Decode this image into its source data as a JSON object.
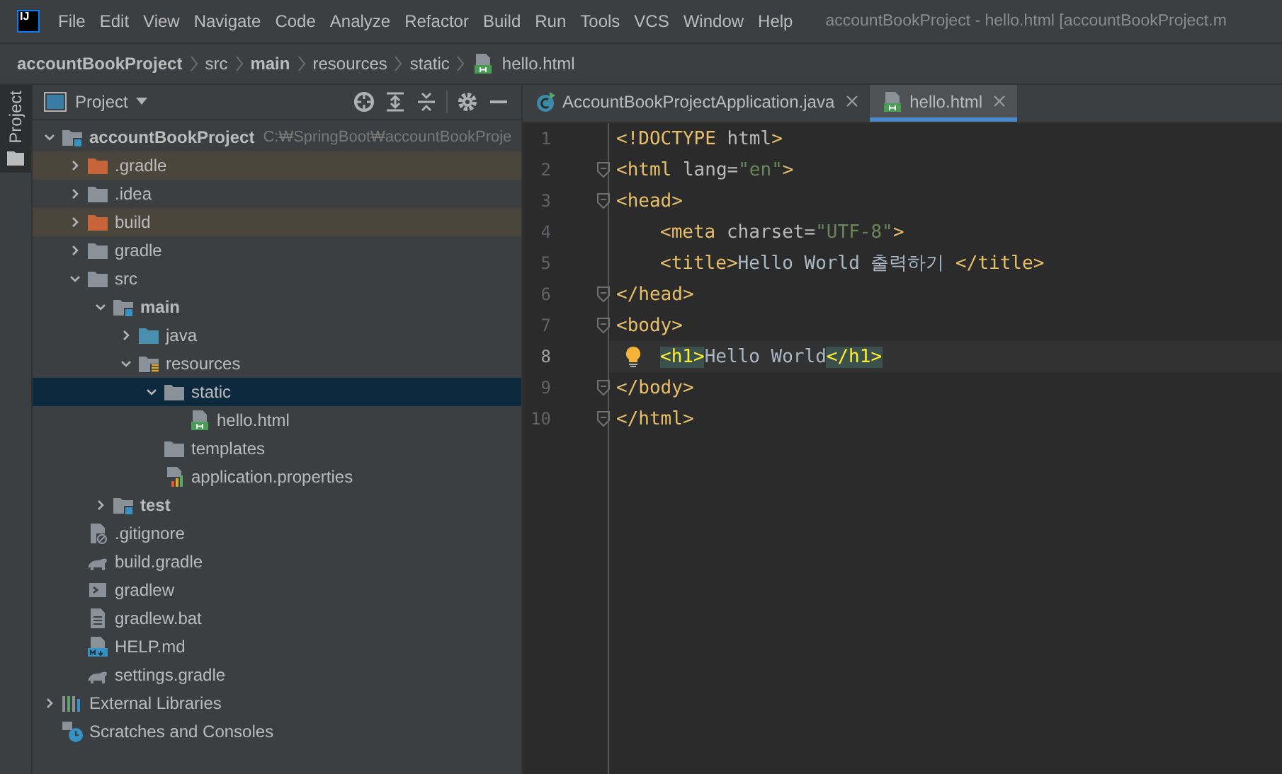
{
  "menu_bar": {
    "logo": "IJ",
    "items": [
      "File",
      "Edit",
      "View",
      "Navigate",
      "Code",
      "Analyze",
      "Refactor",
      "Build",
      "Run",
      "Tools",
      "VCS",
      "Window",
      "Help"
    ],
    "title": "accountBookProject - hello.html [accountBookProject.m"
  },
  "breadcrumb": [
    {
      "label": "accountBookProject",
      "bold": true,
      "kind": "plain"
    },
    {
      "label": "src",
      "bold": false,
      "kind": "plain"
    },
    {
      "label": "main",
      "bold": true,
      "kind": "plain"
    },
    {
      "label": "resources",
      "bold": false,
      "kind": "plain"
    },
    {
      "label": "static",
      "bold": false,
      "kind": "plain"
    },
    {
      "label": "hello.html",
      "bold": false,
      "kind": "html"
    }
  ],
  "side_stripe": {
    "label": "Project",
    "selected": true
  },
  "project_panel": {
    "title": "Project",
    "tree": [
      {
        "label": "accountBookProject",
        "path": "C:₩SpringBoot₩accountBookProje",
        "kind": "module",
        "bold": true,
        "expanded": true,
        "selected": false,
        "excluded": false,
        "children": [
          {
            "label": ".gradle",
            "kind": "folder-excluded",
            "bold": false,
            "expanded": false,
            "selected": false,
            "excluded": true
          },
          {
            "label": ".idea",
            "kind": "folder",
            "bold": false,
            "expanded": false,
            "selected": false,
            "excluded": false
          },
          {
            "label": "build",
            "kind": "folder-excluded",
            "bold": false,
            "expanded": false,
            "selected": false,
            "excluded": true
          },
          {
            "label": "gradle",
            "kind": "folder",
            "bold": false,
            "expanded": false,
            "selected": false,
            "excluded": false
          },
          {
            "label": "src",
            "kind": "folder",
            "bold": false,
            "expanded": true,
            "selected": false,
            "excluded": false,
            "children": [
              {
                "label": "main",
                "kind": "module",
                "bold": true,
                "expanded": true,
                "selected": false,
                "excluded": false,
                "children": [
                  {
                    "label": "java",
                    "kind": "folder-source",
                    "bold": false,
                    "expanded": false,
                    "selected": false,
                    "excluded": false
                  },
                  {
                    "label": "resources",
                    "kind": "folder-resources",
                    "bold": false,
                    "expanded": true,
                    "selected": false,
                    "excluded": false,
                    "children": [
                      {
                        "label": "static",
                        "kind": "folder",
                        "bold": false,
                        "expanded": true,
                        "selected": true,
                        "excluded": false,
                        "children": [
                          {
                            "label": "hello.html",
                            "kind": "html",
                            "bold": false,
                            "selected": false,
                            "excluded": false
                          }
                        ]
                      },
                      {
                        "label": "templates",
                        "kind": "folder",
                        "bold": false,
                        "selected": false,
                        "excluded": false
                      },
                      {
                        "label": "application.properties",
                        "kind": "properties",
                        "bold": false,
                        "selected": false,
                        "excluded": false
                      }
                    ]
                  }
                ]
              },
              {
                "label": "test",
                "kind": "module",
                "bold": true,
                "expanded": false,
                "selected": false,
                "excluded": false
              }
            ]
          },
          {
            "label": ".gitignore",
            "kind": "gitignore",
            "bold": false,
            "selected": false,
            "excluded": false
          },
          {
            "label": "build.gradle",
            "kind": "gradle",
            "bold": false,
            "selected": false,
            "excluded": false
          },
          {
            "label": "gradlew",
            "kind": "script",
            "bold": false,
            "selected": false,
            "excluded": false
          },
          {
            "label": "gradlew.bat",
            "kind": "text",
            "bold": false,
            "selected": false,
            "excluded": false
          },
          {
            "label": "HELP.md",
            "kind": "markdown",
            "bold": false,
            "selected": false,
            "excluded": false
          },
          {
            "label": "settings.gradle",
            "kind": "gradle",
            "bold": false,
            "selected": false,
            "excluded": false
          }
        ]
      },
      {
        "label": "External Libraries",
        "kind": "libraries",
        "bold": false,
        "expanded": false,
        "selected": false,
        "excluded": false
      },
      {
        "label": "Scratches and Consoles",
        "kind": "scratches",
        "bold": false,
        "selected": false,
        "excluded": false
      }
    ]
  },
  "editor": {
    "tabs": [
      {
        "label": "AccountBookProjectApplication.java",
        "kind": "java",
        "selected": false
      },
      {
        "label": "hello.html",
        "kind": "html",
        "selected": true
      }
    ],
    "lines": [
      {
        "number": "1",
        "indented": false,
        "fold": false,
        "current": false,
        "bulb": false,
        "tokens": [
          {
            "kind": "tag",
            "text": "<!DOCTYPE "
          },
          {
            "kind": "attr",
            "text": "html"
          },
          {
            "kind": "tag",
            "text": ">"
          }
        ]
      },
      {
        "number": "2",
        "indented": false,
        "fold": true,
        "current": false,
        "bulb": false,
        "tokens": [
          {
            "kind": "tag",
            "text": "<html "
          },
          {
            "kind": "attr",
            "text": "lang="
          },
          {
            "kind": "str",
            "text": "\"en\""
          },
          {
            "kind": "tag",
            "text": ">"
          }
        ]
      },
      {
        "number": "3",
        "indented": false,
        "fold": true,
        "current": false,
        "bulb": false,
        "tokens": [
          {
            "kind": "tag",
            "text": "<head>"
          }
        ]
      },
      {
        "number": "4",
        "indented": true,
        "fold": false,
        "current": false,
        "bulb": false,
        "tokens": [
          {
            "kind": "tag",
            "text": "<meta "
          },
          {
            "kind": "attr",
            "text": "charset="
          },
          {
            "kind": "str",
            "text": "\"UTF-8\""
          },
          {
            "kind": "tag",
            "text": ">"
          }
        ]
      },
      {
        "number": "5",
        "indented": true,
        "fold": false,
        "current": false,
        "bulb": false,
        "tokens": [
          {
            "kind": "tag",
            "text": "<title>"
          },
          {
            "kind": "text",
            "text": "Hello World 출력하기 "
          },
          {
            "kind": "tag",
            "text": "</title>"
          }
        ]
      },
      {
        "number": "6",
        "indented": false,
        "fold": true,
        "current": false,
        "bulb": false,
        "tokens": [
          {
            "kind": "tag",
            "text": "</head>"
          }
        ]
      },
      {
        "number": "7",
        "indented": false,
        "fold": true,
        "current": false,
        "bulb": false,
        "tokens": [
          {
            "kind": "tag",
            "text": "<body>"
          }
        ]
      },
      {
        "number": "8",
        "indented": true,
        "fold": false,
        "current": true,
        "bulb": true,
        "tokens": [
          {
            "kind": "tag-match",
            "text": "<h1>"
          },
          {
            "kind": "text",
            "text": "Hello World"
          },
          {
            "kind": "tag-match",
            "text": "</h1>"
          }
        ]
      },
      {
        "number": "9",
        "indented": false,
        "fold": true,
        "current": false,
        "bulb": false,
        "tokens": [
          {
            "kind": "tag",
            "text": "</body>"
          }
        ]
      },
      {
        "number": "10",
        "indented": false,
        "fold": true,
        "current": false,
        "bulb": false,
        "tokens": [
          {
            "kind": "tag",
            "text": "</html>"
          }
        ]
      }
    ]
  }
}
